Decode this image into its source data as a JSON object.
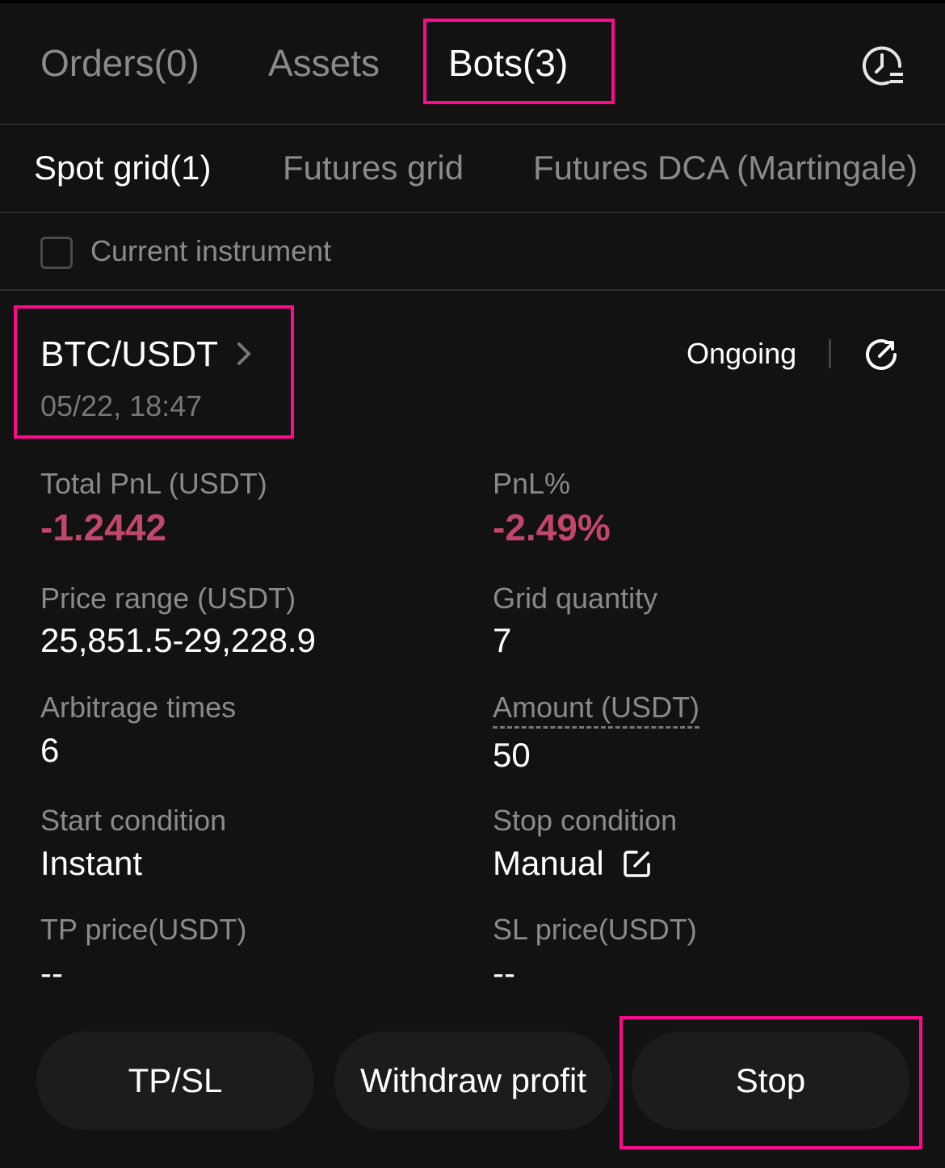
{
  "main_tabs": [
    {
      "label": "Orders(0)",
      "active": false
    },
    {
      "label": "Assets",
      "active": false
    },
    {
      "label": "Bots(3)",
      "active": true
    }
  ],
  "history_icon": "clock-list-icon",
  "bot_tabs": [
    {
      "label": "Spot grid(1)",
      "active": true
    },
    {
      "label": "Futures grid",
      "active": false
    },
    {
      "label": "Futures DCA (Martingale)",
      "active": false
    }
  ],
  "filter": {
    "label": "Current instrument",
    "checked": false
  },
  "bot": {
    "pair": "BTC/USDT",
    "created": "05/22, 18:47",
    "status": "Ongoing",
    "fields": {
      "total_pnl_label": "Total PnL (USDT)",
      "total_pnl_value": "-1.2442",
      "pnl_pct_label": "PnL%",
      "pnl_pct_value": "-2.49%",
      "price_range_label": "Price range (USDT)",
      "price_range_value": "25,851.5-29,228.9",
      "grid_qty_label": "Grid quantity",
      "grid_qty_value": "7",
      "arb_label": "Arbitrage times",
      "arb_value": "6",
      "amount_label": "Amount (USDT)",
      "amount_value": "50",
      "start_label": "Start condition",
      "start_value": "Instant",
      "stop_label": "Stop condition",
      "stop_value": "Manual",
      "tp_label": "TP price(USDT)",
      "tp_value": "--",
      "sl_label": "SL price(USDT)",
      "sl_value": "--"
    }
  },
  "actions": {
    "tpsl": "TP/SL",
    "withdraw": "Withdraw profit",
    "stop": "Stop"
  },
  "colors": {
    "negative": "#c2476a",
    "highlight": "#ff0a8c",
    "background": "#121212"
  }
}
